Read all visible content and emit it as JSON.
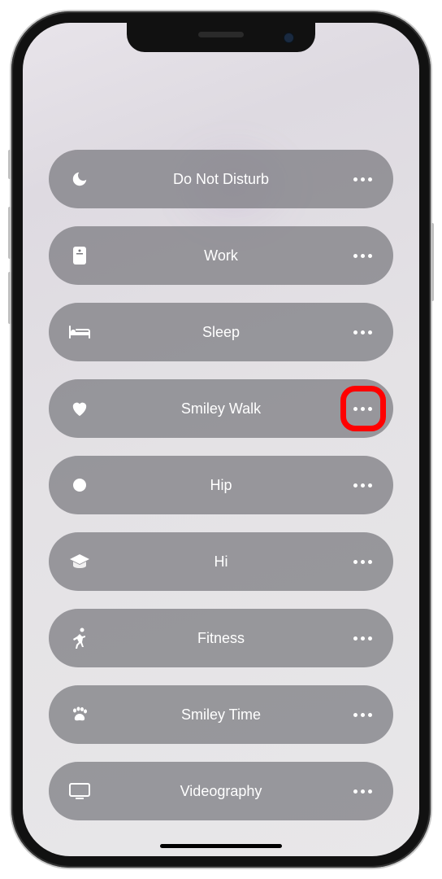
{
  "focus_modes": [
    {
      "id": "dnd",
      "icon": "moon-icon",
      "label": "Do Not Disturb",
      "highlighted": false
    },
    {
      "id": "work",
      "icon": "badge-icon",
      "label": "Work",
      "highlighted": false
    },
    {
      "id": "sleep",
      "icon": "bed-icon",
      "label": "Sleep",
      "highlighted": false
    },
    {
      "id": "smiley-walk",
      "icon": "heart-icon",
      "label": "Smiley Walk",
      "highlighted": true
    },
    {
      "id": "hip",
      "icon": "circle-icon",
      "label": "Hip",
      "highlighted": false
    },
    {
      "id": "hi",
      "icon": "graduation-icon",
      "label": "Hi",
      "highlighted": false
    },
    {
      "id": "fitness",
      "icon": "running-icon",
      "label": "Fitness",
      "highlighted": false
    },
    {
      "id": "smiley-time",
      "icon": "paw-icon",
      "label": "Smiley Time",
      "highlighted": false
    },
    {
      "id": "videography",
      "icon": "display-icon",
      "label": "Videography",
      "highlighted": false
    }
  ],
  "colors": {
    "pill_background": "rgba(120,120,126,0.72)",
    "highlight_ring": "#ff0000",
    "text": "#ffffff"
  }
}
